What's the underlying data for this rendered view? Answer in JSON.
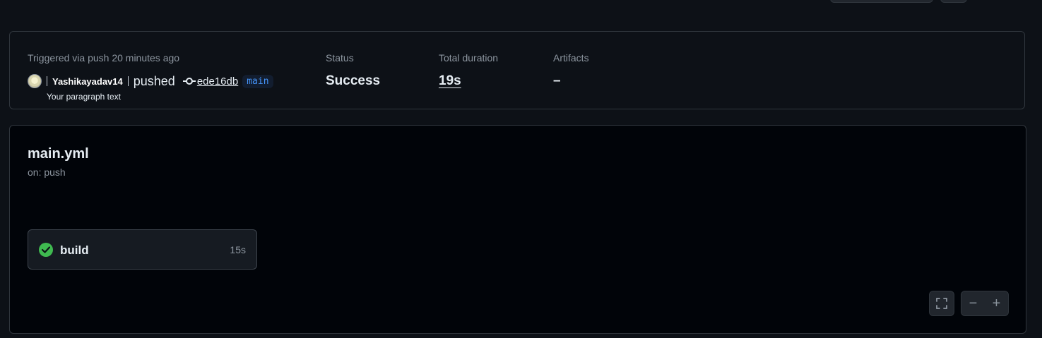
{
  "summary": {
    "triggered_label": "Triggered via push 20 minutes ago",
    "actor": {
      "username": "Yashikayadav14",
      "action": "pushed",
      "commit_sha": "ede16db",
      "branch": "main",
      "subtext": "Your paragraph text"
    },
    "status": {
      "label": "Status",
      "value": "Success"
    },
    "duration": {
      "label": "Total duration",
      "value": "19s"
    },
    "artifacts": {
      "label": "Artifacts",
      "value": "–"
    }
  },
  "workflow": {
    "name": "main.yml",
    "trigger": "on: push",
    "jobs": [
      {
        "name": "build",
        "duration": "15s",
        "status": "success",
        "icon": "check-circle-icon"
      }
    ]
  },
  "controls": {
    "fullscreen_icon": "fullscreen-icon",
    "zoom_out_label": "−",
    "zoom_in_label": "+"
  },
  "colors": {
    "background": "#0d1117",
    "graph_background": "#010409",
    "border": "#30363d",
    "success": "#3fb950",
    "branch_accent": "#4493f8",
    "muted_text": "#8d96a0"
  }
}
